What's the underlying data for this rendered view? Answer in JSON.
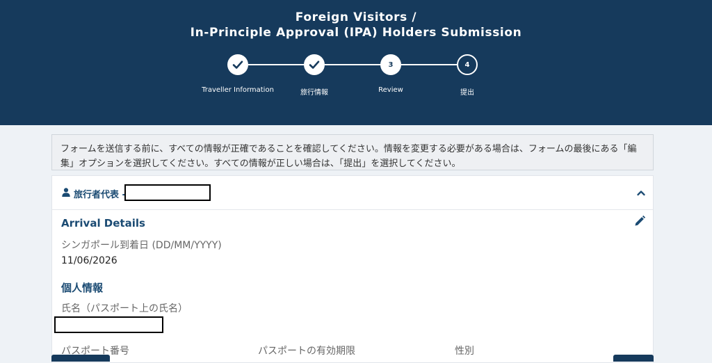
{
  "header": {
    "title_line1": "Foreign Visitors /",
    "title_line2": "In-Principle Approval (IPA) Holders Submission"
  },
  "steps": [
    {
      "label": "Traveller Information",
      "state": "completed"
    },
    {
      "label": "旅行情報",
      "state": "completed"
    },
    {
      "label": "Review",
      "number": "3",
      "state": "current"
    },
    {
      "label": "提出",
      "number": "4",
      "state": "upcoming"
    }
  ],
  "notice": {
    "text": "フォームを送信する前に、すべての情報が正確であることを確認してください。情報を変更する必要がある場合は、フォームの最後にある「編集」オプションを選択してください。すべての情報が正しい場合は、「提出」を選択してください。"
  },
  "traveller_card": {
    "title": "旅行者代表 -",
    "icon": "user-icon",
    "toggle_icon": "chevron-up-icon",
    "edit_icon": "pencil-icon",
    "arrival_details": {
      "heading": "Arrival Details",
      "arrival_date_label": "シンガポール到着日 (DD/MM/YYYY)",
      "arrival_date_value": "11/06/2026"
    },
    "personal_info": {
      "heading": "個人情報",
      "name_label": "氏名（パスポート上の氏名）",
      "passport_number_label": "パスポート番号",
      "passport_expiry_label": "パスポートの有効期限",
      "gender_label": "性別"
    }
  },
  "colors": {
    "header_bg": "#163a5c",
    "accent": "#1b4b73",
    "page_bg": "#eef2f6"
  }
}
